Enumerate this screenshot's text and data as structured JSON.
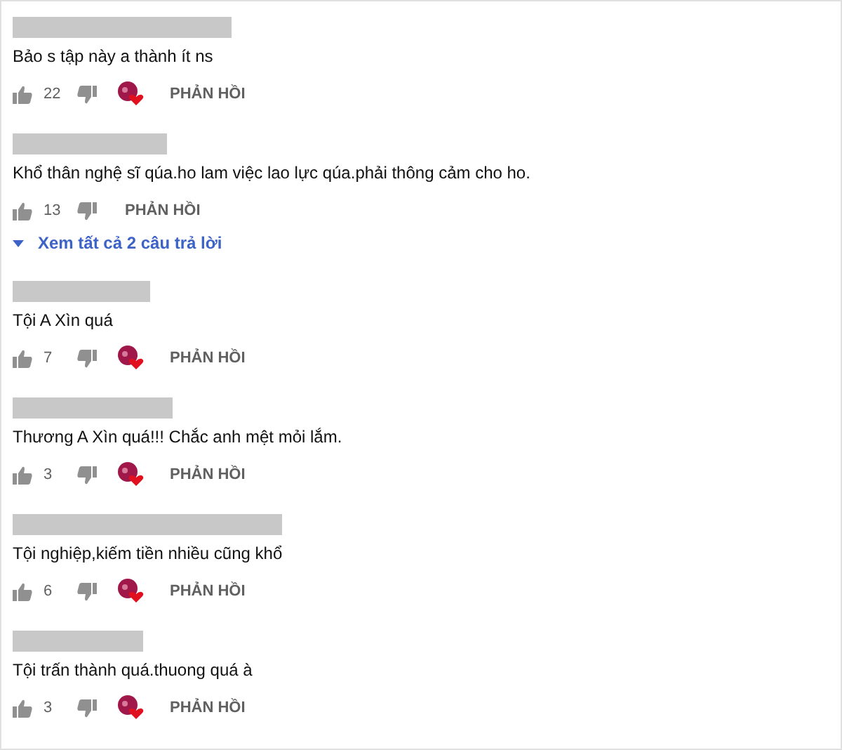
{
  "comments": [
    {
      "text": "Bảo s tập này a thành ít ns",
      "likes": "22",
      "hearted": true,
      "reply": "PHẢN HỒI"
    },
    {
      "text": "Khổ thân nghệ sĩ qúa.ho lam việc lao lực qúa.phải thông cảm cho ho.",
      "likes": "13",
      "hearted": false,
      "reply": "PHẢN HỒI",
      "view_replies": "Xem tất cả 2 câu trả lời"
    },
    {
      "text": "Tội A Xìn quá",
      "likes": "7",
      "hearted": true,
      "reply": "PHẢN HỒI"
    },
    {
      "text": "Thương A Xìn quá!!! Chắc anh mệt mỏi lắm.",
      "likes": "3",
      "hearted": true,
      "reply": "PHẢN HỒI"
    },
    {
      "text": "Tội nghiệp,kiếm tiền nhiều cũng khổ",
      "likes": "6",
      "hearted": true,
      "reply": "PHẢN HỒI"
    },
    {
      "text": "Tội trấn thành quá.thuong quá à",
      "likes": "3",
      "hearted": true,
      "reply": "PHẢN HỒI"
    }
  ]
}
